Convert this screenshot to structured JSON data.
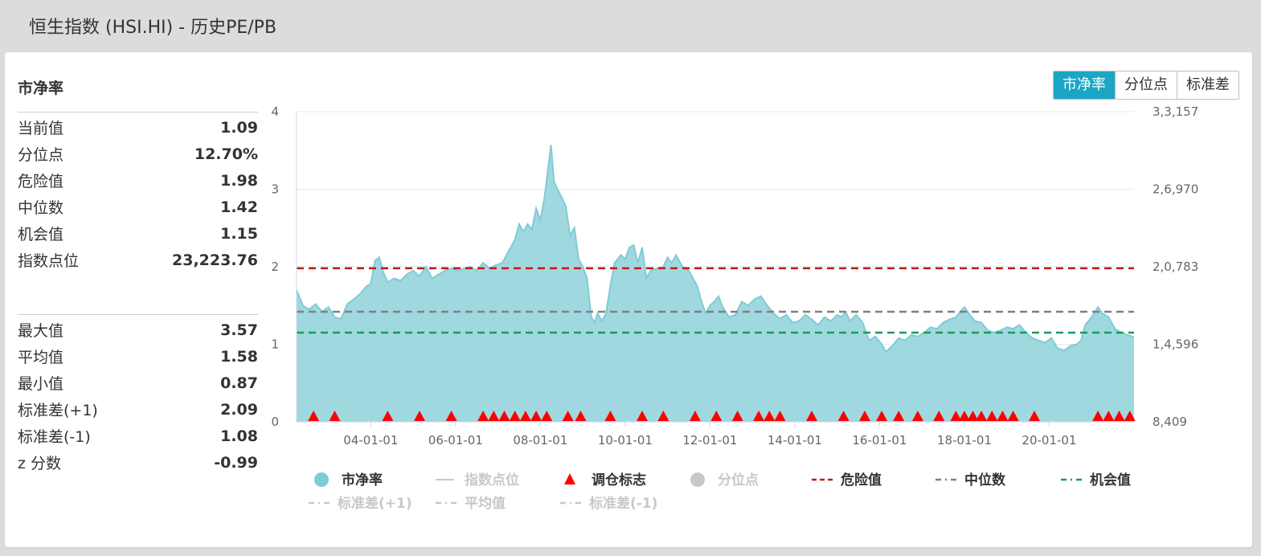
{
  "page_title": "恒生指数 (HSI.HI) - 历史PE/PB",
  "panel": {
    "title": "市净率",
    "stats_top": [
      {
        "label": "当前值",
        "value": "1.09"
      },
      {
        "label": "分位点",
        "value": "12.70%"
      },
      {
        "label": "危险值",
        "value": "1.98"
      },
      {
        "label": "中位数",
        "value": "1.42"
      },
      {
        "label": "机会值",
        "value": "1.15"
      },
      {
        "label": "指数点位",
        "value": "23,223.76"
      }
    ],
    "stats_bottom": [
      {
        "label": "最大值",
        "value": "3.57"
      },
      {
        "label": "平均值",
        "value": "1.58"
      },
      {
        "label": "最小值",
        "value": "0.87"
      },
      {
        "label": "标准差(+1)",
        "value": "2.09"
      },
      {
        "label": "标准差(-1)",
        "value": "1.08"
      },
      {
        "label": "z 分数",
        "value": "-0.99"
      }
    ]
  },
  "tabs": [
    {
      "label": "市净率",
      "active": true
    },
    {
      "label": "分位点",
      "active": false
    },
    {
      "label": "标准差",
      "active": false
    }
  ],
  "colors": {
    "area_fill": "#a0d8e0",
    "area_line": "#80cbd6",
    "danger": "#c01a1a",
    "median": "#808080",
    "opportunity": "#1a9a5a",
    "marker": "#ff0000",
    "disabled_legend": "#c8c8c8",
    "active_tab": "#1aa6c4"
  },
  "chart_data": {
    "type": "area",
    "y_left": {
      "min": 0,
      "max": 4,
      "ticks": [
        "0",
        "1",
        "2",
        "3",
        "4"
      ]
    },
    "y_right": {
      "ticks": [
        "8,409",
        "1,4,596",
        "2,0,783",
        "2,6,970",
        "3,3,157"
      ]
    },
    "x_range": [
      2002.25,
      2022.0
    ],
    "x_ticks": [
      {
        "value": 2004.0,
        "label": "04-01-01"
      },
      {
        "value": 2006.0,
        "label": "06-01-01"
      },
      {
        "value": 2008.0,
        "label": "08-01-01"
      },
      {
        "value": 2010.0,
        "label": "10-01-01"
      },
      {
        "value": 2012.0,
        "label": "12-01-01"
      },
      {
        "value": 2014.0,
        "label": "14-01-01"
      },
      {
        "value": 2016.0,
        "label": "16-01-01"
      },
      {
        "value": 2018.0,
        "label": "18-01-01"
      },
      {
        "value": 2020.0,
        "label": "20-01-01"
      }
    ],
    "pb_series": {
      "name": "市净率",
      "points": [
        [
          2002.25,
          1.7
        ],
        [
          2002.4,
          1.5
        ],
        [
          2002.55,
          1.45
        ],
        [
          2002.7,
          1.52
        ],
        [
          2002.85,
          1.42
        ],
        [
          2003.0,
          1.48
        ],
        [
          2003.15,
          1.35
        ],
        [
          2003.3,
          1.33
        ],
        [
          2003.45,
          1.52
        ],
        [
          2003.6,
          1.58
        ],
        [
          2003.75,
          1.65
        ],
        [
          2003.9,
          1.75
        ],
        [
          2004.0,
          1.78
        ],
        [
          2004.1,
          2.08
        ],
        [
          2004.2,
          2.12
        ],
        [
          2004.3,
          1.92
        ],
        [
          2004.4,
          1.8
        ],
        [
          2004.55,
          1.85
        ],
        [
          2004.7,
          1.82
        ],
        [
          2004.85,
          1.9
        ],
        [
          2005.0,
          1.95
        ],
        [
          2005.15,
          1.88
        ],
        [
          2005.3,
          2.0
        ],
        [
          2005.45,
          1.85
        ],
        [
          2005.6,
          1.9
        ],
        [
          2005.75,
          1.95
        ],
        [
          2005.9,
          1.98
        ],
        [
          2006.05,
          1.95
        ],
        [
          2006.2,
          1.98
        ],
        [
          2006.35,
          2.0
        ],
        [
          2006.5,
          1.95
        ],
        [
          2006.65,
          2.05
        ],
        [
          2006.8,
          1.98
        ],
        [
          2006.95,
          2.02
        ],
        [
          2007.1,
          2.05
        ],
        [
          2007.25,
          2.2
        ],
        [
          2007.4,
          2.35
        ],
        [
          2007.5,
          2.55
        ],
        [
          2007.6,
          2.45
        ],
        [
          2007.7,
          2.55
        ],
        [
          2007.8,
          2.48
        ],
        [
          2007.9,
          2.75
        ],
        [
          2008.0,
          2.6
        ],
        [
          2008.1,
          2.9
        ],
        [
          2008.2,
          3.35
        ],
        [
          2008.25,
          3.57
        ],
        [
          2008.32,
          3.1
        ],
        [
          2008.4,
          3.0
        ],
        [
          2008.5,
          2.9
        ],
        [
          2008.6,
          2.78
        ],
        [
          2008.7,
          2.4
        ],
        [
          2008.8,
          2.5
        ],
        [
          2008.9,
          2.1
        ],
        [
          2009.0,
          2.0
        ],
        [
          2009.1,
          1.85
        ],
        [
          2009.2,
          1.35
        ],
        [
          2009.28,
          1.28
        ],
        [
          2009.35,
          1.4
        ],
        [
          2009.45,
          1.3
        ],
        [
          2009.55,
          1.4
        ],
        [
          2009.65,
          1.75
        ],
        [
          2009.75,
          2.05
        ],
        [
          2009.9,
          2.15
        ],
        [
          2010.0,
          2.1
        ],
        [
          2010.1,
          2.25
        ],
        [
          2010.2,
          2.28
        ],
        [
          2010.3,
          2.05
        ],
        [
          2010.4,
          2.25
        ],
        [
          2010.5,
          1.85
        ],
        [
          2010.6,
          1.95
        ],
        [
          2010.75,
          1.98
        ],
        [
          2010.9,
          2.0
        ],
        [
          2011.0,
          2.12
        ],
        [
          2011.1,
          2.05
        ],
        [
          2011.2,
          2.15
        ],
        [
          2011.35,
          2.0
        ],
        [
          2011.5,
          1.95
        ],
        [
          2011.6,
          1.85
        ],
        [
          2011.7,
          1.75
        ],
        [
          2011.8,
          1.55
        ],
        [
          2011.9,
          1.4
        ],
        [
          2012.0,
          1.5
        ],
        [
          2012.1,
          1.55
        ],
        [
          2012.2,
          1.62
        ],
        [
          2012.3,
          1.48
        ],
        [
          2012.45,
          1.35
        ],
        [
          2012.6,
          1.38
        ],
        [
          2012.75,
          1.55
        ],
        [
          2012.9,
          1.5
        ],
        [
          2013.05,
          1.58
        ],
        [
          2013.2,
          1.62
        ],
        [
          2013.35,
          1.5
        ],
        [
          2013.5,
          1.4
        ],
        [
          2013.65,
          1.33
        ],
        [
          2013.8,
          1.38
        ],
        [
          2013.95,
          1.28
        ],
        [
          2014.1,
          1.3
        ],
        [
          2014.25,
          1.38
        ],
        [
          2014.4,
          1.32
        ],
        [
          2014.55,
          1.25
        ],
        [
          2014.7,
          1.35
        ],
        [
          2014.85,
          1.3
        ],
        [
          2015.0,
          1.38
        ],
        [
          2015.1,
          1.35
        ],
        [
          2015.2,
          1.42
        ],
        [
          2015.3,
          1.3
        ],
        [
          2015.45,
          1.38
        ],
        [
          2015.6,
          1.28
        ],
        [
          2015.75,
          1.05
        ],
        [
          2015.9,
          1.1
        ],
        [
          2016.05,
          1.0
        ],
        [
          2016.15,
          0.9
        ],
        [
          2016.3,
          0.98
        ],
        [
          2016.45,
          1.08
        ],
        [
          2016.6,
          1.05
        ],
        [
          2016.75,
          1.12
        ],
        [
          2016.9,
          1.1
        ],
        [
          2017.05,
          1.15
        ],
        [
          2017.2,
          1.22
        ],
        [
          2017.35,
          1.2
        ],
        [
          2017.5,
          1.28
        ],
        [
          2017.65,
          1.32
        ],
        [
          2017.8,
          1.35
        ],
        [
          2017.9,
          1.42
        ],
        [
          2018.0,
          1.48
        ],
        [
          2018.1,
          1.4
        ],
        [
          2018.25,
          1.3
        ],
        [
          2018.4,
          1.28
        ],
        [
          2018.55,
          1.18
        ],
        [
          2018.7,
          1.15
        ],
        [
          2018.85,
          1.18
        ],
        [
          2019.0,
          1.22
        ],
        [
          2019.15,
          1.2
        ],
        [
          2019.3,
          1.25
        ],
        [
          2019.45,
          1.15
        ],
        [
          2019.6,
          1.08
        ],
        [
          2019.75,
          1.05
        ],
        [
          2019.9,
          1.02
        ],
        [
          2020.05,
          1.08
        ],
        [
          2020.2,
          0.95
        ],
        [
          2020.35,
          0.92
        ],
        [
          2020.5,
          0.98
        ],
        [
          2020.65,
          1.0
        ],
        [
          2020.75,
          1.05
        ],
        [
          2020.85,
          1.25
        ],
        [
          2021.0,
          1.35
        ],
        [
          2021.15,
          1.48
        ],
        [
          2021.25,
          1.4
        ],
        [
          2021.4,
          1.35
        ],
        [
          2021.55,
          1.2
        ],
        [
          2021.7,
          1.15
        ],
        [
          2021.85,
          1.12
        ],
        [
          2022.0,
          1.09
        ]
      ]
    },
    "reference_lines": [
      {
        "name": "危险值",
        "value": 1.98,
        "color": "#c01a1a"
      },
      {
        "name": "中位数",
        "value": 1.42,
        "color": "#808080"
      },
      {
        "name": "机会值",
        "value": 1.15,
        "color": "#1a9a5a"
      }
    ],
    "rebalance_markers": [
      2002.65,
      2003.15,
      2004.4,
      2005.15,
      2005.9,
      2006.65,
      2006.9,
      2007.15,
      2007.4,
      2007.65,
      2007.9,
      2008.15,
      2008.65,
      2008.95,
      2009.65,
      2010.4,
      2010.9,
      2011.65,
      2012.15,
      2012.65,
      2013.15,
      2013.4,
      2013.65,
      2014.4,
      2015.15,
      2015.65,
      2016.05,
      2016.45,
      2016.9,
      2017.4,
      2017.8,
      2018.0,
      2018.2,
      2018.4,
      2018.65,
      2018.9,
      2019.15,
      2019.65,
      2021.15,
      2021.4,
      2021.65,
      2021.9,
      2022.15,
      2022.4
    ],
    "legend": [
      {
        "label": "市净率",
        "shape": "circle",
        "color": "#80cbd6",
        "enabled": true
      },
      {
        "label": "指数点位",
        "shape": "line",
        "color": "#c8c8c8",
        "enabled": false
      },
      {
        "label": "调仓标志",
        "shape": "triangle",
        "color": "#ff0000",
        "enabled": true
      },
      {
        "label": "分位点",
        "shape": "circle",
        "color": "#c8c8c8",
        "enabled": false
      },
      {
        "label": "危险值",
        "shape": "dash",
        "color": "#c01a1a",
        "enabled": true
      },
      {
        "label": "中位数",
        "shape": "dashdot",
        "color": "#808080",
        "enabled": true
      },
      {
        "label": "机会值",
        "shape": "dashdot",
        "color": "#1a9a5a",
        "enabled": true
      },
      {
        "label": "标准差(+1)",
        "shape": "dashdot",
        "color": "#c8c8c8",
        "enabled": false
      },
      {
        "label": "平均值",
        "shape": "dashdot",
        "color": "#c8c8c8",
        "enabled": false
      },
      {
        "label": "标准差(-1)",
        "shape": "dashdot",
        "color": "#c8c8c8",
        "enabled": false
      }
    ]
  }
}
